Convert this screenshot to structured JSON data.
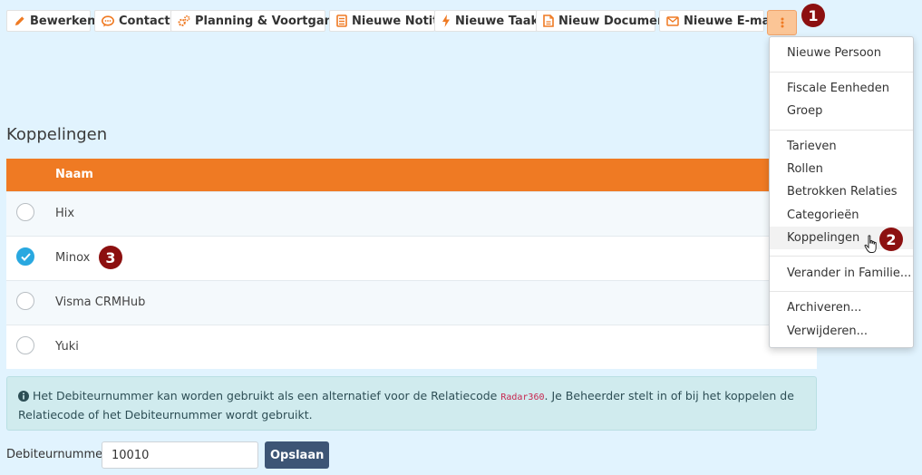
{
  "toolbar": {
    "items": [
      {
        "label": "Bewerken",
        "icon": "pencil-icon"
      },
      {
        "label": "Contact",
        "icon": "chat-icon"
      },
      {
        "label": "Planning & Voortgang",
        "icon": "cogs-icon"
      },
      {
        "label": "Nieuwe Notitie",
        "icon": "note-icon"
      },
      {
        "label": "Nieuwe Taak",
        "icon": "bolt-icon"
      },
      {
        "label": "Nieuw Document",
        "icon": "document-icon"
      },
      {
        "label": "Nieuwe E-mail",
        "icon": "envelope-icon"
      }
    ],
    "more_icon": "vertical-ellipsis-icon"
  },
  "markers": [
    "1",
    "2",
    "3"
  ],
  "section": {
    "title": "Koppelingen"
  },
  "table": {
    "column": "Naam",
    "rows": [
      {
        "name": "Hix",
        "selected": false
      },
      {
        "name": "Minox",
        "selected": true
      },
      {
        "name": "Visma CRMHub",
        "selected": false
      },
      {
        "name": "Yuki",
        "selected": false
      }
    ]
  },
  "info": {
    "text_before": "Het Debiteurnummer kan worden gebruikt als een alternatief voor de Relatiecode",
    "code": "Radar360",
    "text_after": ". Je Beheerder stelt in of bij het koppelen de Relatiecode of het Debiteurnummer wordt gebruikt.",
    "icon": "info-circle-icon"
  },
  "form": {
    "label": "Debiteurnummer",
    "value": "10010",
    "save_label": "Opslaan"
  },
  "dropdown": {
    "items": [
      "Nieuwe Persoon",
      "Fiscale Eenheden",
      "Groep",
      "Tarieven",
      "Rollen",
      "Betrokken Relaties",
      "Categorieën",
      "Koppelingen",
      "Verander in Familie...",
      "Archiveren...",
      "Verwijderen..."
    ]
  },
  "colors": {
    "accent": "#ef7a23",
    "marker": "#8c1010",
    "check": "#29a8e0",
    "button": "#3d5575",
    "background": "#e1f3fe"
  }
}
